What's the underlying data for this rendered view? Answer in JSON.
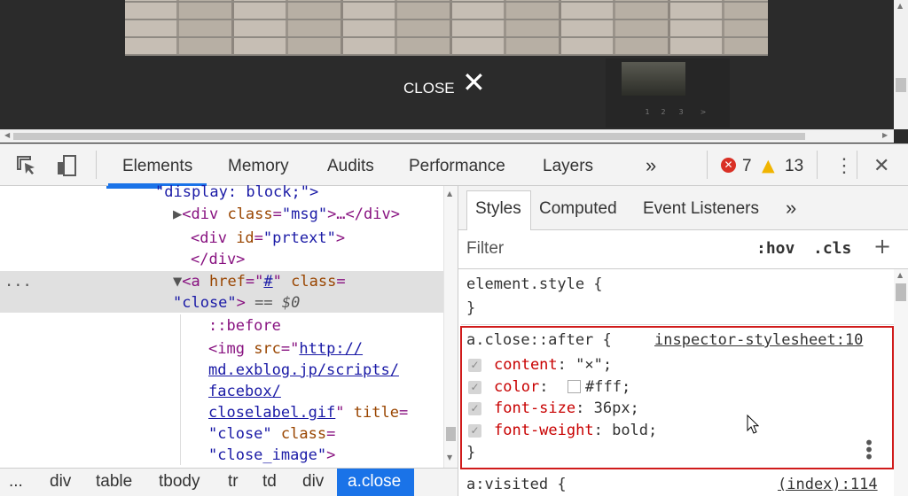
{
  "page": {
    "close_label": "CLOSE",
    "close_glyph": "✕",
    "pagination": [
      "1",
      "2",
      "3",
      ">"
    ]
  },
  "toolbar": {
    "tabs": [
      "Elements",
      "Memory",
      "Audits",
      "Performance",
      "Layers"
    ],
    "more": "»",
    "error_count": "7",
    "warning_count": "13",
    "menu_icon": "⋮",
    "close_icon": "✕"
  },
  "elements": {
    "lines": {
      "l0_val": "\"display: block;\">",
      "l1_tag_open": "<div",
      "l1_attr": " class",
      "l1_eq": "=",
      "l1_val": "\"msg\"",
      "l1_rest": ">…</div>",
      "l2_tag_open": "<div",
      "l2_attr": " id",
      "l2_eq": "=",
      "l2_val": "\"prtext\"",
      "l2_close": ">",
      "l3": "</div>",
      "l4_tag_open": "<a",
      "l4_attr1": " href",
      "l4_eq1": "=\"",
      "l4_link": "#",
      "l4_q": "\"",
      "l4_attr2": " class",
      "l4_eq2": "=",
      "l5_val": "\"close\"",
      "l5_close": ">",
      "l5_eq0": " == $0",
      "l6": "::before",
      "l7_tag": "<img",
      "l7_attr": " src",
      "l7_eq": "=\"",
      "l7_link": "http://",
      "l8_link": "md.exblog.jp/scripts/",
      "l9_link": "facebox/",
      "l10_link": "closelabel.gif",
      "l10_q": "\"",
      "l10_attr": " title",
      "l10_eq": "=",
      "l11_val": "\"close\"",
      "l11_attr": " class",
      "l11_eq": "=",
      "l12_val": "\"close_image\"",
      "l12_close": ">"
    },
    "dots": "..."
  },
  "breadcrumbs": [
    "...",
    "div",
    "table",
    "tbody",
    "tr",
    "td",
    "div",
    "a.close"
  ],
  "styles": {
    "tabs": [
      "Styles",
      "Computed",
      "Event Listeners"
    ],
    "more": "»",
    "filter_placeholder": "Filter",
    "hov": ":hov",
    "cls": ".cls",
    "add": "+",
    "element_style": "element.style {",
    "brace_close": "}",
    "rule_selector": "a.close::after {",
    "rule_source": "inspector-stylesheet:10",
    "declarations": [
      {
        "prop": "content",
        "value": "\"×\";"
      },
      {
        "prop": "color",
        "value": "#fff;"
      },
      {
        "prop": "font-size",
        "value": "36px;"
      },
      {
        "prop": "font-weight",
        "value": "bold;"
      }
    ],
    "next_selector": "a:visited {",
    "next_source": "(index):114"
  }
}
